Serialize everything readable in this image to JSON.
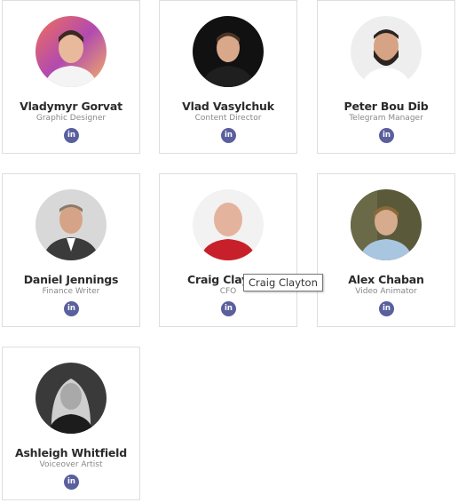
{
  "team": [
    {
      "name": "Vladymyr Gorvat",
      "role": "Graphic Designer",
      "social": "in",
      "avatar": "photo-young-man-colorful-bg"
    },
    {
      "name": "Vlad Vasylchuk",
      "role": "Content Director",
      "social": "in",
      "avatar": "photo-man-black-bg"
    },
    {
      "name": "Peter Bou Dib",
      "role": "Telegram Manager",
      "social": "in",
      "avatar": "photo-bearded-man"
    },
    {
      "name": "Daniel Jennings",
      "role": "Finance Writer",
      "social": "in",
      "avatar": "photo-man-in-suit"
    },
    {
      "name": "Craig Clayton",
      "role": "CFO",
      "social": "in",
      "avatar": "photo-bald-man"
    },
    {
      "name": "Alex Chaban",
      "role": "Video Animator",
      "social": "in",
      "avatar": "photo-man-outdoors"
    },
    {
      "name": "Ashleigh Whitfield",
      "role": "Voiceover Artist",
      "social": "in",
      "avatar": "photo-woman-bw"
    }
  ],
  "tooltip": {
    "text": "Craig Clayton"
  },
  "colors": {
    "linkedin_badge": "#5a5f9e",
    "card_border": "#dedede",
    "name_text": "#2b2b2b",
    "role_text": "#888888"
  }
}
